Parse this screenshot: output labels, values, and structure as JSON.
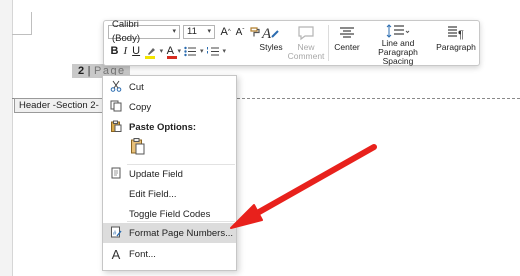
{
  "toolbar": {
    "font_name": "Calibri (Body)",
    "font_size": "11",
    "styles_label": "Styles",
    "new_comment_label": "New\nComment",
    "center_label": "Center",
    "line_spacing_label": "Line and Paragraph\nSpacing",
    "paragraph_label": "Paragraph"
  },
  "document": {
    "page_number": "2",
    "page_pipe": "|",
    "page_word": "Page",
    "header_tag": "Header -Section 2-"
  },
  "context_menu": {
    "items": [
      {
        "label": "Cut",
        "icon": "scissors-icon"
      },
      {
        "label": "Copy",
        "icon": "copy-icon"
      },
      {
        "label": "Paste Options:",
        "icon": "paste-icon"
      },
      {
        "label": "Update Field",
        "icon": "update-field-icon"
      },
      {
        "label": "Edit Field...",
        "icon": ""
      },
      {
        "label": "Toggle Field Codes",
        "icon": ""
      },
      {
        "label": "Format Page Numbers...",
        "icon": "format-page-numbers-icon"
      },
      {
        "label": "Font...",
        "icon": "font-icon"
      }
    ],
    "highlighted": "Format Page Numbers..."
  },
  "colors": {
    "highlight": "#f2e400",
    "font_color": "#d62b1f",
    "arrow": "#e8211c",
    "menu_hover": "#dcdcdc"
  }
}
